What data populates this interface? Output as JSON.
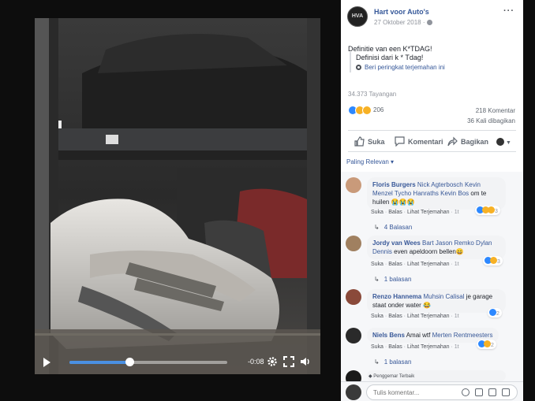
{
  "post": {
    "page_name": "Hart voor Auto's",
    "date": "27 Oktober 2018 ·",
    "text": "Definitie van een K*TDAG!",
    "translated_text": "Definisi dari k * Tdag!",
    "rate_translation": "Beri peringkat terjemahan ini",
    "views": "34.373 Tayangan",
    "reaction_count": "206",
    "comment_count": "218 Komentar",
    "share_count": "36 Kali dibagikan",
    "avatar_text": "HVA"
  },
  "video": {
    "time": "-0:08",
    "progress": 0.38
  },
  "actions": {
    "like": "Suka",
    "comment": "Komentari",
    "share": "Bagikan"
  },
  "sort_label": "Paling Relevan ▾",
  "comment_actions": {
    "like": "Suka",
    "reply": "Balas",
    "translate": "Lihat Terjemahan",
    "age": "1t"
  },
  "comments": [
    {
      "name": "Floris Burgers",
      "tags": "Nick Agterbosch Kevin Menzel Tycho Hanraths Kevin Bos",
      "text": "om te huilen 😭😭😭",
      "reactions": "3",
      "replies": "4 Balasan"
    },
    {
      "name": "Jordy van Wees",
      "tags": "Bart Jason Remko Dylan Dennis",
      "text": "even apeldoorn bellen😄",
      "reactions": "3",
      "replies": "1 balasan"
    },
    {
      "name": "Renzo Hannema",
      "tags": "Muhsin Calisal",
      "text": "je garage staat onder water 😂",
      "reactions": "2",
      "replies": ""
    },
    {
      "name": "Niels Bens",
      "tags": "Merten Rentmeesters",
      "text": "Amai wtf",
      "reactions": "2",
      "replies": "1 balasan"
    }
  ],
  "top_fan": "Penggemar Terbaik",
  "input": {
    "placeholder": "Tulis komentar..."
  },
  "colors": {
    "link": "#385898",
    "like": "#2d88ff",
    "emoji": "#f7b125",
    "accent": "#4a90e2"
  }
}
